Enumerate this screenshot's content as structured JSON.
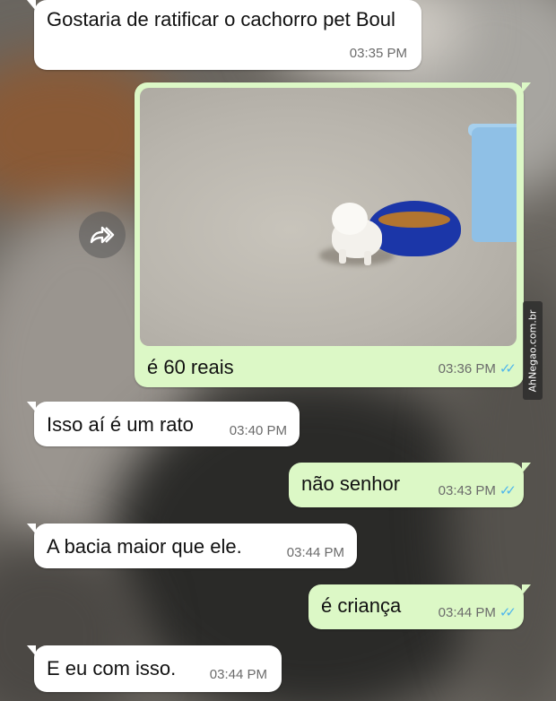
{
  "messages": [
    {
      "text": "Gostaria de ratificar o cachorro pet Boul",
      "time": "03:35 PM"
    },
    {
      "text": "é 60 reais",
      "time": "03:36 PM"
    },
    {
      "text": "Isso aí é um rato",
      "time": "03:40 PM"
    },
    {
      "text": "não senhor",
      "time": "03:43 PM"
    },
    {
      "text": "A bacia maior que ele.",
      "time": "03:44 PM"
    },
    {
      "text": "é criança",
      "time": "03:44 PM"
    },
    {
      "text": "E eu com isso.",
      "time": "03:44 PM"
    }
  ],
  "watermark": "AhNegao.com.br",
  "icons": {
    "forward": "forward-icon",
    "read_receipt": "double-check-icon"
  },
  "colors": {
    "incoming_bubble": "#ffffff",
    "outgoing_bubble": "#dcf8c6",
    "read_ticks": "#4fb6ec"
  }
}
